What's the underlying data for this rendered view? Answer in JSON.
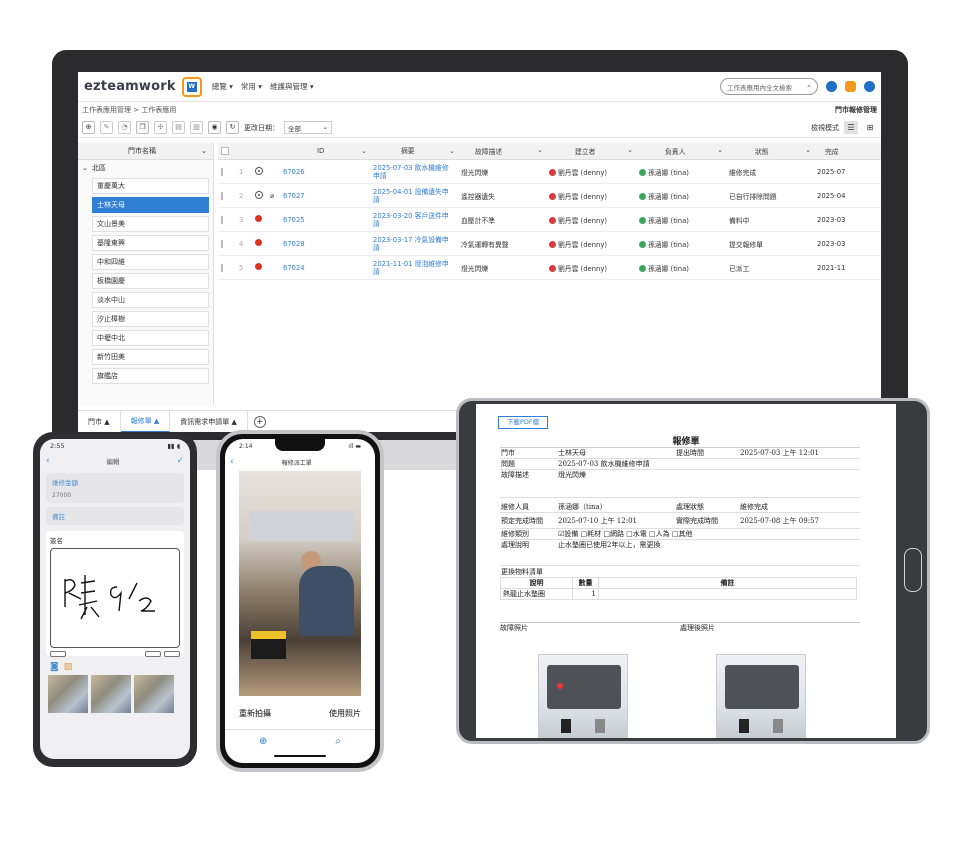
{
  "desktop": {
    "logo": "ezteamwork",
    "logo_badge": "W",
    "menus": [
      "總覽 ▾",
      "常用 ▾",
      "維護與管理 ▾"
    ],
    "search_placeholder": "工作表應用內全文檢索",
    "breadcrumb": "工作表應用管理 > 工作表應用",
    "page_title": "門市報修管理",
    "date_filter_label": "更改日期：",
    "date_filter_value": "全部",
    "view_mode_label": "檢視模式",
    "sidebar": {
      "header": "門市名稱",
      "group": "北區",
      "items": [
        "重慶萬大",
        "士林天母",
        "文山景美",
        "基隆東興",
        "中和四維",
        "板橋園慶",
        "淡水中山",
        "汐止樟樹",
        "中壢中北",
        "新竹田美",
        "旗艦店"
      ],
      "active_index": 1
    },
    "table": {
      "columns": [
        "ID",
        "摘要",
        "故障描述",
        "建立者",
        "負責人",
        "狀態",
        "完成"
      ],
      "rows": [
        {
          "n": "1",
          "status": "ring",
          "attach": false,
          "id": "67026",
          "summary": "2025-07-03 飲水機維修申請",
          "desc": "燈光閃爍",
          "creator": "劉丹雲 (denny)",
          "assignee": "孫涵娜 (tina)",
          "state": "維修完成",
          "date": "2025-07"
        },
        {
          "n": "2",
          "status": "ring",
          "attach": true,
          "id": "67027",
          "summary": "2025-04-01 設備遺失申請",
          "desc": "遙控器遺失",
          "creator": "劉丹雲 (denny)",
          "assignee": "孫涵娜 (tina)",
          "state": "已自行排除問題",
          "date": "2025-04"
        },
        {
          "n": "3",
          "status": "dot",
          "attach": false,
          "id": "67025",
          "summary": "2023-03-20 客戶送件申請",
          "desc": "血壓計不準",
          "creator": "劉丹雲 (denny)",
          "assignee": "孫涵娜 (tina)",
          "state": "備料中",
          "date": "2023-03"
        },
        {
          "n": "4",
          "status": "dot",
          "attach": false,
          "id": "67028",
          "summary": "2023-03-17 冷氣設備申請",
          "desc": "冷氣運轉有異聲",
          "creator": "劉丹雲 (denny)",
          "assignee": "孫涵娜 (tina)",
          "state": "提交報修單",
          "date": "2023-03"
        },
        {
          "n": "5",
          "status": "dot",
          "attach": false,
          "id": "67024",
          "summary": "2021-11-01 燈泡維修申請",
          "desc": "燈光閃爍",
          "creator": "劉丹雲 (denny)",
          "assignee": "孫涵娜 (tina)",
          "state": "已派工",
          "date": "2021-11"
        }
      ]
    },
    "tabs": [
      "門市 ▲",
      "報修單 ▲",
      "資訊需求申請單 ▲"
    ]
  },
  "phone_left": {
    "time": "2:55",
    "title": "編輯",
    "field1_label": "維修金額",
    "field1_value": "27000",
    "field2_label": "備註",
    "sign_label": "簽名",
    "signature": "陳 9/2"
  },
  "phone_mid": {
    "time": "2:14",
    "title": "報修派工單",
    "retake": "重新拍攝",
    "use_photo": "使用照片"
  },
  "tablet": {
    "pdf_button": "下載PDF檔",
    "title": "報修單",
    "store_label": "門市",
    "store_value": "士林天母",
    "submit_label": "提出時間",
    "submit_value": "2025-07-03 上午 12:01",
    "issue_label": "問題",
    "issue_value": "2025-07-03 飲水機維修申請",
    "fault_label": "故障描述",
    "fault_value": "燈光閃爍",
    "staff_label": "維修人員",
    "staff_value": "孫涵娜（tina）",
    "status_label": "處理狀態",
    "status_value": "維修完成",
    "planned_label": "預定完成時間",
    "planned_value": "2025-07-10 上午 12:01",
    "actual_label": "實際完成時間",
    "actual_value": "2025-07-08 上午 09:57",
    "category_label": "維修類別",
    "category_value": "☑設備 □耗材 □網路 □水電 □人為 □其他",
    "handling_label": "處理說明",
    "handling_value": "止水墊圈已使用2年以上，需更換",
    "materials_label": "更換物料清單",
    "mat_headers": [
      "說明",
      "數量",
      "備註"
    ],
    "mat_row": [
      "熱龍止水墊圈",
      "1",
      ""
    ],
    "before_label": "故障照片",
    "after_label": "處理後照片"
  }
}
